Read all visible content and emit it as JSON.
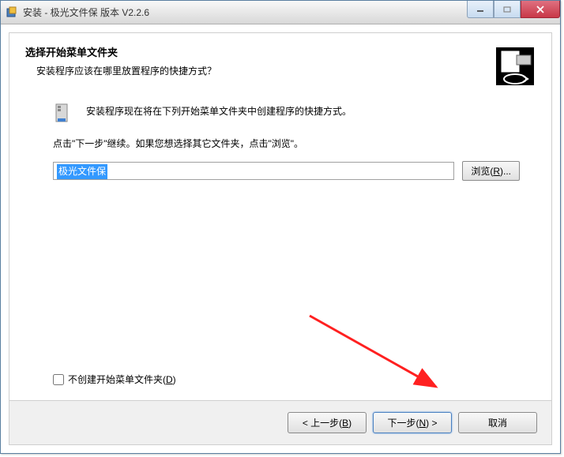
{
  "window": {
    "title": "安装 - 极光文件保 版本 V2.2.6"
  },
  "header": {
    "title": "选择开始菜单文件夹",
    "subtitle": "安装程序应该在哪里放置程序的快捷方式？"
  },
  "body": {
    "line1": "安装程序现在将在下列开始菜单文件夹中创建程序的快捷方式。",
    "line2": "点击\"下一步\"继续。如果您想选择其它文件夹，点击\"浏览\"。",
    "folder_value": "极光文件保",
    "browse_label": "浏览(R)...",
    "browse_key": "R",
    "checkbox_label": "不创建开始菜单文件夹(D)",
    "checkbox_key": "D"
  },
  "footer": {
    "back_label": "< 上一步(B)",
    "back_key": "B",
    "next_label": "下一步(N) >",
    "next_key": "N",
    "cancel_label": "取消"
  },
  "colors": {
    "arrow": "#ff2020",
    "selection": "#3399ff"
  }
}
